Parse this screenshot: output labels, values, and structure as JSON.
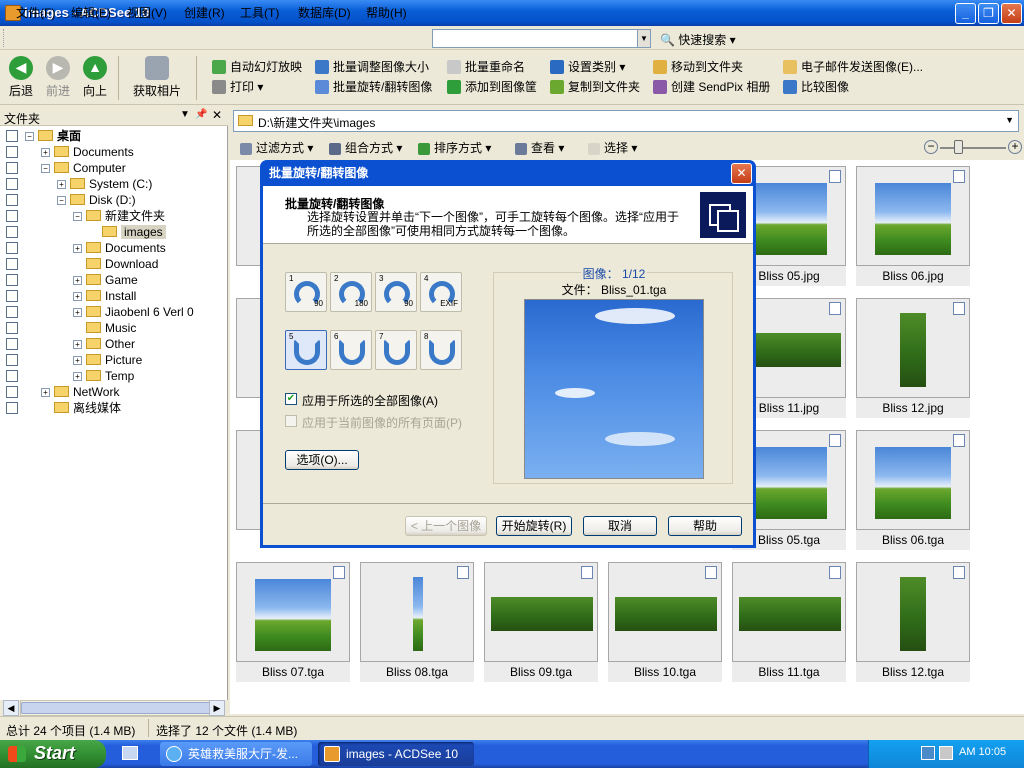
{
  "window": {
    "title": "images - ACDSee 10"
  },
  "menu": [
    "文件(F)",
    "编辑(E)",
    "视图(V)",
    "创建(R)",
    "工具(T)",
    "数据库(D)",
    "帮助(H)"
  ],
  "search": {
    "value": "",
    "quick_label": "快速搜索"
  },
  "toolbar": {
    "back": "后退",
    "forward": "前进",
    "up": "向上",
    "acquire": "获取相片",
    "slideshow": "自动幻灯放映",
    "print": "打印",
    "batch_resize": "批量调整图像大小",
    "batch_rotate": "批量旋转/翻转图像",
    "batch_rename": "批量重命名",
    "add_basket": "添加到图像筐",
    "set_category": "设置类别",
    "copy_folder": "复制到文件夹",
    "move_folder": "移动到文件夹",
    "sendpix": "创建 SendPix 相册",
    "email": "电子邮件发送图像(E)...",
    "compare": "比较图像"
  },
  "folders_panel": {
    "title": "文件夹"
  },
  "tree": [
    {
      "label": "桌面",
      "level": 0,
      "expanded": true,
      "bold": true
    },
    {
      "label": "Documents",
      "level": 1,
      "expanded": false
    },
    {
      "label": "Computer",
      "level": 1,
      "expanded": true
    },
    {
      "label": "System (C:)",
      "level": 2,
      "expanded": false
    },
    {
      "label": "Disk (D:)",
      "level": 2,
      "expanded": true
    },
    {
      "label": "新建文件夹",
      "level": 3,
      "expanded": true
    },
    {
      "label": "images",
      "level": 4,
      "selected": true
    },
    {
      "label": "Documents",
      "level": 3,
      "expanded": false
    },
    {
      "label": "Download",
      "level": 3
    },
    {
      "label": "Game",
      "level": 3,
      "expanded": false
    },
    {
      "label": "Install",
      "level": 3,
      "expanded": false
    },
    {
      "label": "Jiaobenl 6 Verl 0",
      "level": 3,
      "expanded": false
    },
    {
      "label": "Music",
      "level": 3
    },
    {
      "label": "Other",
      "level": 3,
      "expanded": false
    },
    {
      "label": "Picture",
      "level": 3,
      "expanded": false
    },
    {
      "label": "Temp",
      "level": 3,
      "expanded": false
    },
    {
      "label": "NetWork",
      "level": 1,
      "expanded": false
    },
    {
      "label": "离线媒体",
      "level": 1
    }
  ],
  "address": "D:\\新建文件夹\\images",
  "subtoolbar": {
    "filter": "过滤方式",
    "group": "组合方式",
    "sort": "排序方式",
    "view": "查看",
    "select": "选择"
  },
  "thumbs": {
    "r1c5": "Bliss 05.jpg",
    "r1c6": "Bliss 06.jpg",
    "r2c5": "Bliss 11.jpg",
    "r2c6": "Bliss 12.jpg",
    "r3c5": "Bliss 05.tga",
    "r3c6": "Bliss 06.tga",
    "r4": [
      "Bliss 07.tga",
      "Bliss 08.tga",
      "Bliss 09.tga",
      "Bliss 10.tga",
      "Bliss 11.tga",
      "Bliss 12.tga"
    ]
  },
  "dialog": {
    "title": "批量旋转/翻转图像",
    "heading": "批量旋转/翻转图像",
    "description": "选择旋转设置并单击“下一个图像”，可手工旋转每个图像。选择“应用于所选的全部图像”可使用相同方式旋转每一个图像。",
    "rotate_buttons": [
      {
        "num": "1",
        "sub": "90"
      },
      {
        "num": "2",
        "sub": "180"
      },
      {
        "num": "3",
        "sub": "90"
      },
      {
        "num": "4",
        "sub": "EXIF"
      },
      {
        "num": "5",
        "sub": ""
      },
      {
        "num": "6",
        "sub": ""
      },
      {
        "num": "7",
        "sub": ""
      },
      {
        "num": "8",
        "sub": ""
      }
    ],
    "apply_all": "应用于所选的全部图像(A)",
    "apply_pages": "应用于当前图像的所有页面(P)",
    "options": "选项(O)...",
    "preview_counter": "图像： 1/12",
    "preview_file": "文件： Bliss_01.tga",
    "prev": "< 上一个图像",
    "start": "开始旋转(R)",
    "cancel": "取消",
    "help": "帮助"
  },
  "status": {
    "total": "总计 24 个项目 (1.4 MB)",
    "selected": "选择了 12 个文件 (1.4 MB)"
  },
  "taskbar": {
    "start": "Start",
    "task1": "英雄救美服大厅-发...",
    "task2": "images - ACDSee 10",
    "clock": "AM 10:05"
  }
}
